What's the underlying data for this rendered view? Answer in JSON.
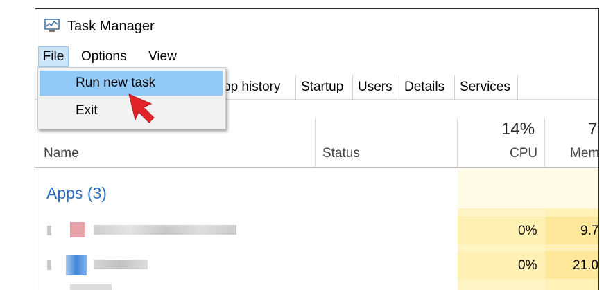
{
  "window": {
    "title": "Task Manager",
    "icon": "task-manager-icon"
  },
  "menubar": {
    "items": [
      "File",
      "Options",
      "View"
    ]
  },
  "file_menu": {
    "items": [
      "Run new task",
      "Exit"
    ]
  },
  "tabs": [
    "pp history",
    "Startup",
    "Users",
    "Details",
    "Services"
  ],
  "columns": {
    "name": "Name",
    "status": "Status",
    "cpu_percent": "14%",
    "cpu": "CPU",
    "mem_percent": "7",
    "mem": "Mem"
  },
  "section": {
    "label": "Apps (3)"
  },
  "rows": [
    {
      "cpu": "0%",
      "mem": "9.7"
    },
    {
      "cpu": "0%",
      "mem": "21.0"
    }
  ],
  "colors": {
    "accent": "#2a6dc4",
    "menu_highlight": "#91c9f7",
    "cpu_column": "#fff4c4",
    "mem_column": "#ffe89a",
    "pointer_arrow": "#e0242a"
  }
}
